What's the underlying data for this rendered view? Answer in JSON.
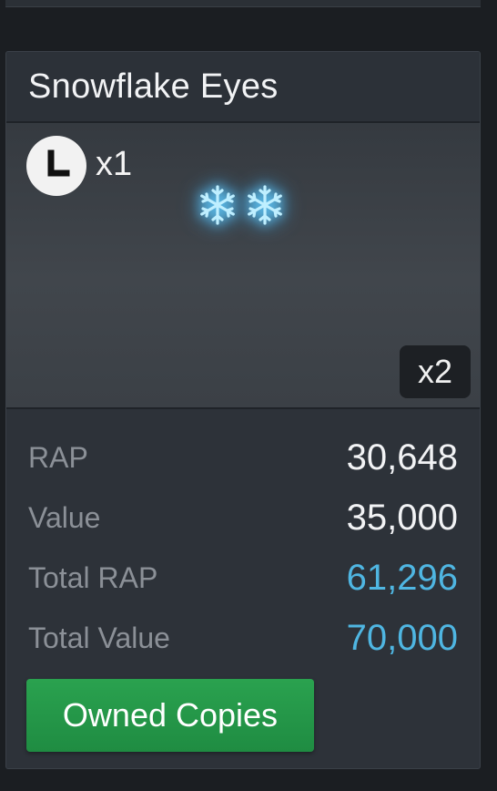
{
  "item": {
    "title": "Snowflake Eyes",
    "owner_count": "x1",
    "quantity_badge": "x2",
    "owner_avatar_icon": "clock-icon",
    "image_icon": "snowflake-eyes-icon"
  },
  "stats": [
    {
      "label": "RAP",
      "value": "30,648",
      "accent": false
    },
    {
      "label": "Value",
      "value": "35,000",
      "accent": false
    },
    {
      "label": "Total RAP",
      "value": "61,296",
      "accent": true
    },
    {
      "label": "Total Value",
      "value": "70,000",
      "accent": true
    }
  ],
  "actions": {
    "owned_copies_label": "Owned Copies"
  },
  "colors": {
    "accent_blue": "#4fb6e2",
    "button_green": "#22994a",
    "card_bg": "#2d3239"
  }
}
